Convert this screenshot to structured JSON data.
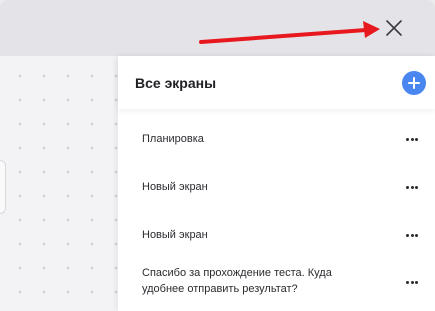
{
  "panel": {
    "title": "Все экраны",
    "add_icon": "plus-icon",
    "close_icon": "close-icon"
  },
  "screens": [
    {
      "label": "Планировка"
    },
    {
      "label": "Новый экран"
    },
    {
      "label": "Новый экран"
    },
    {
      "label": "Спасибо за прохождение теста. Куда удобнее отправить результат?"
    }
  ],
  "colors": {
    "accent": "#4a86ef",
    "annotation_arrow": "#e8191e"
  }
}
